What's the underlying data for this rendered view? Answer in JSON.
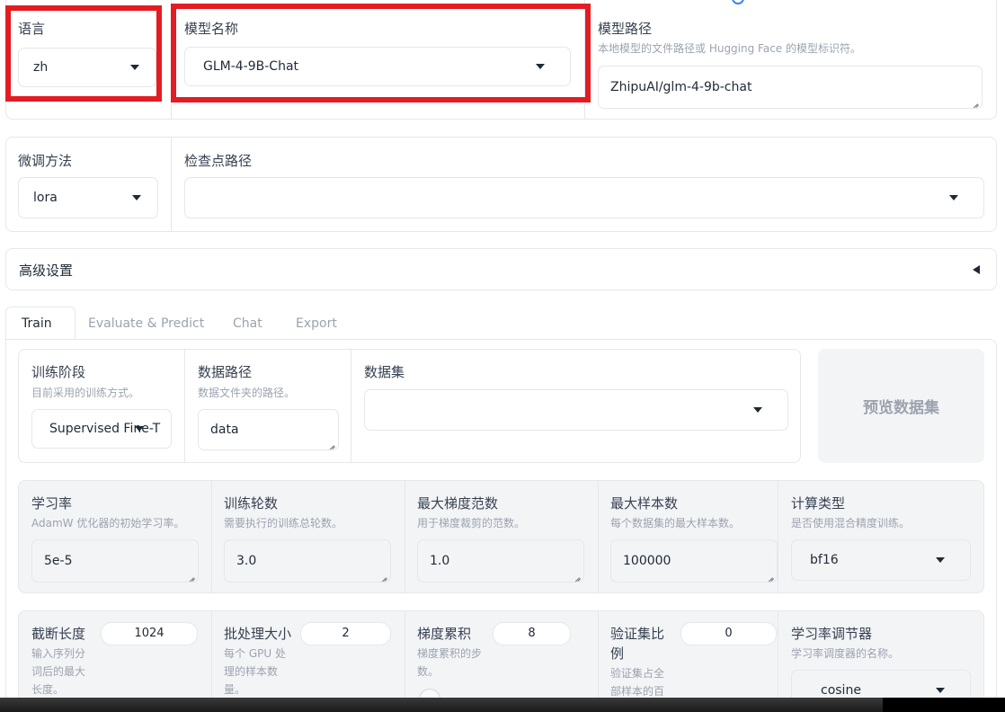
{
  "top": {
    "lang": {
      "label": "语言",
      "value": "zh"
    },
    "model_name": {
      "label": "模型名称",
      "value": "GLM-4-9B-Chat"
    },
    "model_path": {
      "label": "模型路径",
      "desc": "本地模型的文件路径或 Hugging Face 的模型标识符。",
      "value": "ZhipuAI/glm-4-9b-chat"
    }
  },
  "finetune": {
    "method": {
      "label": "微调方法",
      "value": "lora"
    },
    "checkpoint": {
      "label": "检查点路径",
      "value": ""
    }
  },
  "advanced": {
    "label": "高级设置"
  },
  "tabs": [
    {
      "label": "Train"
    },
    {
      "label": "Evaluate & Predict"
    },
    {
      "label": "Chat"
    },
    {
      "label": "Export"
    }
  ],
  "train": {
    "stage": {
      "label": "训练阶段",
      "desc": "目前采用的训练方式。",
      "value": "Supervised Fine-T"
    },
    "data_path": {
      "label": "数据路径",
      "desc": "数据文件夹的路径。",
      "value": "data"
    },
    "dataset": {
      "label": "数据集",
      "value": ""
    },
    "preview_button": "预览数据集",
    "row1": {
      "lr": {
        "label": "学习率",
        "desc": "AdamW 优化器的初始学习率。",
        "value": "5e-5"
      },
      "epochs": {
        "label": "训练轮数",
        "desc": "需要执行的训练总轮数。",
        "value": "3.0"
      },
      "max_grad": {
        "label": "最大梯度范数",
        "desc": "用于梯度裁剪的范数。",
        "value": "1.0"
      },
      "max_samples": {
        "label": "最大样本数",
        "desc": "每个数据集的最大样本数。",
        "value": "100000"
      },
      "compute": {
        "label": "计算类型",
        "desc": "是否使用混合精度训练。",
        "value": "bf16"
      }
    },
    "row2": {
      "cutoff": {
        "label": "截断长度",
        "desc": [
          "输入序列分",
          "词后的最大",
          "长度。"
        ],
        "value": "1024"
      },
      "batch": {
        "label": "批处理大小",
        "desc": [
          "每个 GPU 处",
          "理的样本数",
          "量。"
        ],
        "value": "2"
      },
      "grad_accum": {
        "label": "梯度累积",
        "desc": [
          "梯度累积的步",
          "数。"
        ],
        "value": "8"
      },
      "val_ratio": {
        "label": [
          "验证集比",
          "例"
        ],
        "desc": [
          "验证集占全",
          "部样本的百"
        ],
        "value": "0"
      },
      "scheduler": {
        "label": "学习率调节器",
        "desc": "学习率调度器的名称。",
        "value": "cosine"
      }
    }
  },
  "colors": {
    "highlight": "#e31c23",
    "panel": "#f3f4f6",
    "border": "#e5e7eb"
  }
}
